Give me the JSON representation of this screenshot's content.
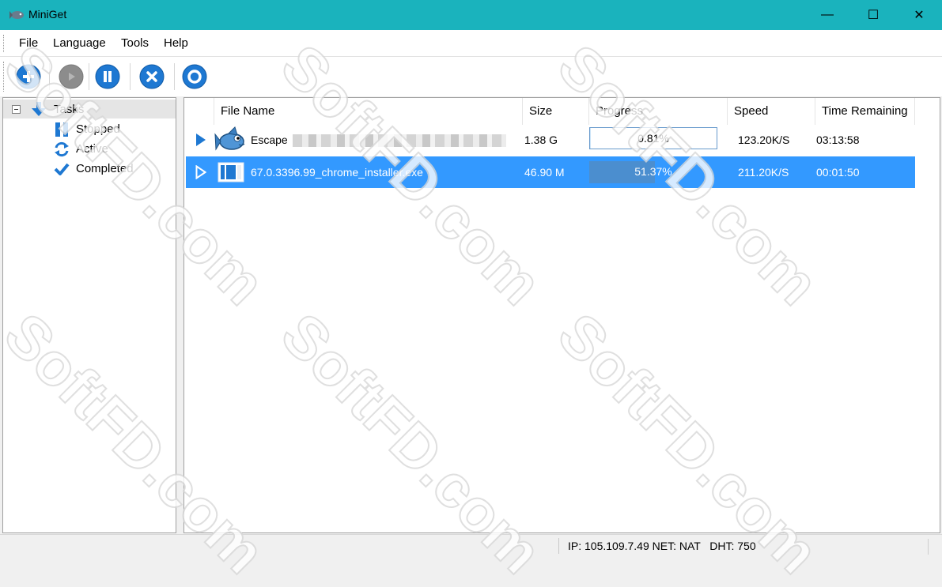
{
  "window": {
    "title": "MiniGet",
    "minimize_glyph": "—",
    "maximize_glyph": "☐",
    "close_glyph": "✕"
  },
  "menu": [
    {
      "label": "File"
    },
    {
      "label": "Language"
    },
    {
      "label": "Tools"
    },
    {
      "label": "Help"
    }
  ],
  "toolbar": {
    "buttons": [
      {
        "icon": "add-icon",
        "enabled": true
      },
      {
        "icon": "play-icon",
        "enabled": false
      },
      {
        "icon": "pause-icon",
        "enabled": true
      },
      {
        "icon": "delete-icon",
        "enabled": true
      },
      {
        "icon": "settings-icon",
        "enabled": true
      }
    ],
    "accent_color": "#1e78d2"
  },
  "sidebar": {
    "root": {
      "label": "Tasks",
      "icon": "down-arrow-icon",
      "expanded": true
    },
    "items": [
      {
        "label": "Stopped",
        "icon": "pause-icon"
      },
      {
        "label": "Active",
        "icon": "refresh-icon"
      },
      {
        "label": "Completed",
        "icon": "checkmark-icon"
      }
    ]
  },
  "table": {
    "columns": [
      "File Name",
      "Size",
      "Progress",
      "Speed",
      "Time Remaining"
    ],
    "rows": [
      {
        "name": "Escape",
        "name_obscured": true,
        "size": "1.38 G",
        "progress": "0.81%",
        "progress_value": 0.81,
        "speed": "123.20K/S",
        "remaining": "03:13:58",
        "selected": false,
        "icon": "fish-icon"
      },
      {
        "name": "67.0.3396.99_chrome_installer.exe",
        "name_obscured": false,
        "size": "46.90 M",
        "progress": "51.37%",
        "progress_value": 51.37,
        "speed": "211.20K/S",
        "remaining": "00:01:50",
        "selected": true,
        "icon": "installer-file-icon"
      }
    ]
  },
  "status": {
    "text": "IP: 105.109.7.49 NET: NAT   DHT: 750"
  },
  "colors": {
    "titlebar": "#1ab3bd",
    "selection": "#3399ff"
  },
  "watermark": "SoftFD.com"
}
